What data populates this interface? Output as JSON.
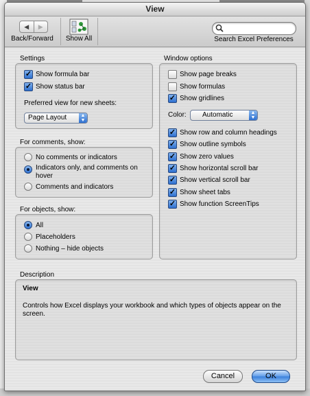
{
  "window": {
    "title": "View"
  },
  "toolbar": {
    "back_forward_label": "Back/Forward",
    "back_glyph": "◀",
    "forward_glyph": "▶",
    "show_all_label": "Show All",
    "search_label": "Search Excel Preferences",
    "search_value": ""
  },
  "settings": {
    "title": "Settings",
    "show_formula_bar": {
      "label": "Show formula bar",
      "checked": true
    },
    "show_status_bar": {
      "label": "Show status bar",
      "checked": true
    },
    "preferred_view_label": "Preferred view for new sheets:",
    "preferred_view_value": "Page Layout"
  },
  "comments": {
    "title": "For comments, show:",
    "options": [
      {
        "label": "No comments or indicators",
        "selected": false
      },
      {
        "label": "Indicators only, and comments on hover",
        "selected": true
      },
      {
        "label": "Comments and indicators",
        "selected": false
      }
    ]
  },
  "objects": {
    "title": "For objects, show:",
    "options": [
      {
        "label": "All",
        "selected": true
      },
      {
        "label": "Placeholders",
        "selected": false
      },
      {
        "label": "Nothing – hide objects",
        "selected": false
      }
    ]
  },
  "window_options": {
    "title": "Window options",
    "checkboxes_top": [
      {
        "label": "Show page breaks",
        "checked": false
      },
      {
        "label": "Show formulas",
        "checked": false
      },
      {
        "label": "Show gridlines",
        "checked": true
      }
    ],
    "color_label": "Color:",
    "color_value": "Automatic",
    "checkboxes_bottom": [
      {
        "label": "Show row and column headings",
        "checked": true
      },
      {
        "label": "Show outline symbols",
        "checked": true
      },
      {
        "label": "Show zero values",
        "checked": true
      },
      {
        "label": "Show horizontal scroll bar",
        "checked": true
      },
      {
        "label": "Show vertical scroll bar",
        "checked": true
      },
      {
        "label": "Show sheet tabs",
        "checked": true
      },
      {
        "label": "Show function ScreenTips",
        "checked": true
      }
    ]
  },
  "description": {
    "title": "Description",
    "heading": "View",
    "body": "Controls how Excel displays your workbook and which types of objects appear on the screen."
  },
  "buttons": {
    "cancel": "Cancel",
    "ok": "OK"
  },
  "colors": {
    "accent": "#3a7fdc",
    "checkbox_on": "#2d6fcf"
  }
}
